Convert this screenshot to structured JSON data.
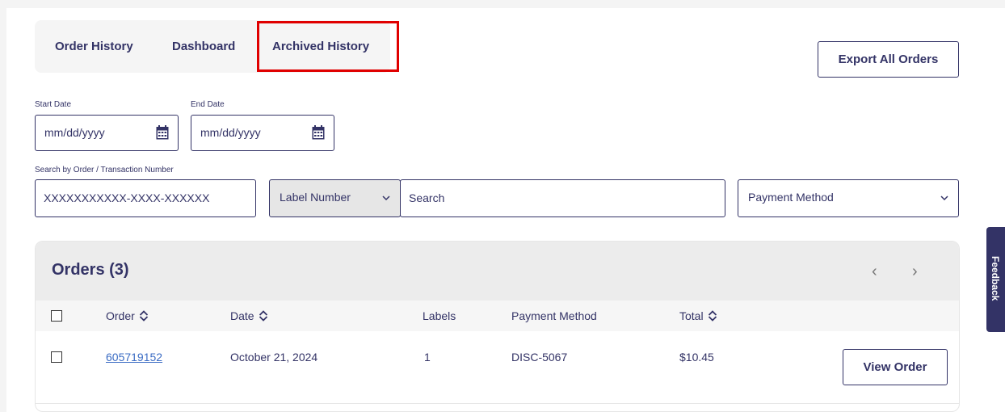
{
  "tabs": [
    {
      "label": "Order History"
    },
    {
      "label": "Dashboard"
    },
    {
      "label": "Archived History",
      "active": true
    }
  ],
  "export_button": {
    "label": "Export All Orders"
  },
  "filters": {
    "start_date": {
      "label": "Start Date",
      "placeholder": "mm/dd/yyyy"
    },
    "end_date": {
      "label": "End Date",
      "placeholder": "mm/dd/yyyy"
    },
    "search_label": "Search by Order / Transaction Number",
    "order_number_placeholder": "XXXXXXXXXXX-XXXX-XXXXXX",
    "label_type_select": {
      "value": "Label Number"
    },
    "search_placeholder": "Search",
    "payment_method_select": {
      "value": "Payment Method"
    }
  },
  "orders": {
    "title": "Orders (3)",
    "columns": {
      "order": "Order",
      "date": "Date",
      "labels": "Labels",
      "payment_method": "Payment Method",
      "total": "Total"
    },
    "rows": [
      {
        "order": "605719152",
        "date": "October 21, 2024",
        "labels": "1",
        "payment_method": "DISC-5067",
        "total": "$10.45",
        "action": "View Order"
      }
    ],
    "pager": {
      "prev": "‹",
      "next": "›"
    }
  },
  "feedback": {
    "label": "Feedback"
  },
  "colors": {
    "brand": "#333366",
    "highlight": "#e00000",
    "link": "#3b6cc4"
  }
}
